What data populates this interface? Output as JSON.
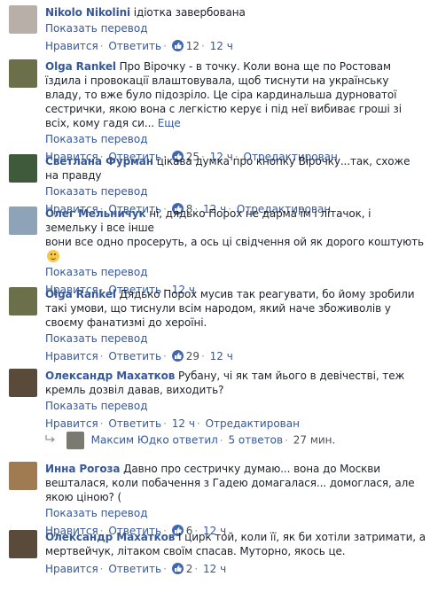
{
  "labels": {
    "translate": "Показать перевод",
    "like": "Нравится",
    "reply": "Ответить",
    "edited": "Отредактирован",
    "more": "Еще"
  },
  "comments": [
    {
      "author": "Nikolo Nikolini",
      "text": "ідіотка завербована",
      "likes": "12",
      "time": "12 ч",
      "avatar_color": "#b8b0a8"
    },
    {
      "author": "Olga Rankel",
      "text": "Про Вірочку - в точку. Коли вона ще по Ростовам їздила і провокації влаштовувала, щоб тиснути на українську владу, то вже було підозріло. Це сіра кардинальша дурноватої сестрички, якою вона с легкістю керує і під неї вибиває гроші зі всіх, кому гадя си...",
      "likes": "25",
      "time": "12 ч",
      "avatar_color": "#6b6f4a"
    },
    {
      "author": "Светлана Фурман",
      "text": "цікава думка про кнопку Вірочку...так, схоже на правду",
      "likes": "8",
      "time": "12 ч",
      "avatar_color": "#3f5a3a"
    },
    {
      "author": "Олег Мельничук",
      "text": "ні, дядько Порох не дарма їм і літачок, і земельку і все інше",
      "text2": "вони все одно просеруть, а ось ці свідчення ой як дорого коштують",
      "time": "12 ч",
      "avatar_color": "#8fa3b8"
    },
    {
      "author": "Olga Rankel",
      "text": "Дядько Порох мусив так реагувати, бо йому зробили такі умови, що тиснули всім народом, який наче збоживолів у своєму фанатизмі до хероїні.",
      "likes": "29",
      "time": "12 ч",
      "avatar_color": "#6b6f4a"
    },
    {
      "author": "Олександр Махатков",
      "text": "Рубану, чі як там йього в девічестві, теж кремль дозвіл давав, виходить?",
      "time": "12 ч",
      "avatar_color": "#5a4a3a"
    },
    {
      "author": "Инна Рогоза",
      "text": "Давно про сестричку думаю... вона до Москви вешталася, коли побачення з Гадею домагалася... домоглася, але якою ціною? (",
      "likes": "6",
      "time": "12 ч",
      "avatar_color": "#a07a50"
    },
    {
      "author": "Олександр Махатков",
      "text": "І цирк той, коли її, як би хотіли затримати, а мертвейчук, літаком своїм спасав. Муторно, якось це.",
      "likes": "2",
      "time": "12 ч",
      "avatar_color": "#5a4a3a"
    }
  ],
  "reply_summary": {
    "name": "Максим Юдко",
    "action": "ответил",
    "count": "5 ответов",
    "time": "27 мин."
  },
  "colors": {
    "link": "#365899",
    "meta": "#90949c",
    "like_badge": "#4267b2"
  }
}
